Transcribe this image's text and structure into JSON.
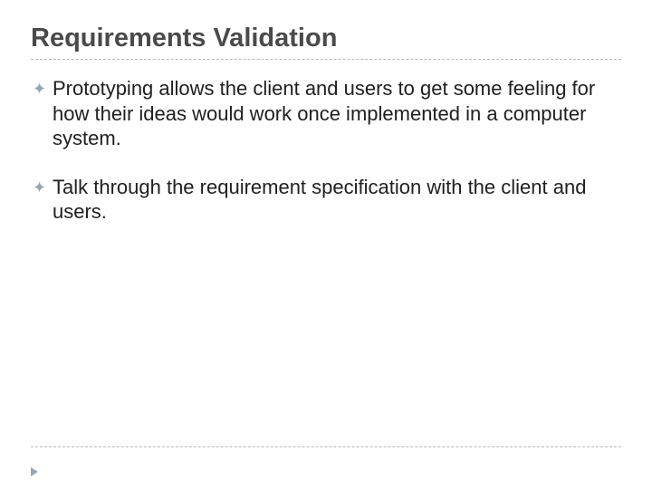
{
  "slide": {
    "title": "Requirements Validation",
    "bullets": [
      "Prototyping allows the client and users to get some feeling for how their ideas would work once implemented in a computer system.",
      "Talk through the requirement specification with the client and users."
    ]
  }
}
